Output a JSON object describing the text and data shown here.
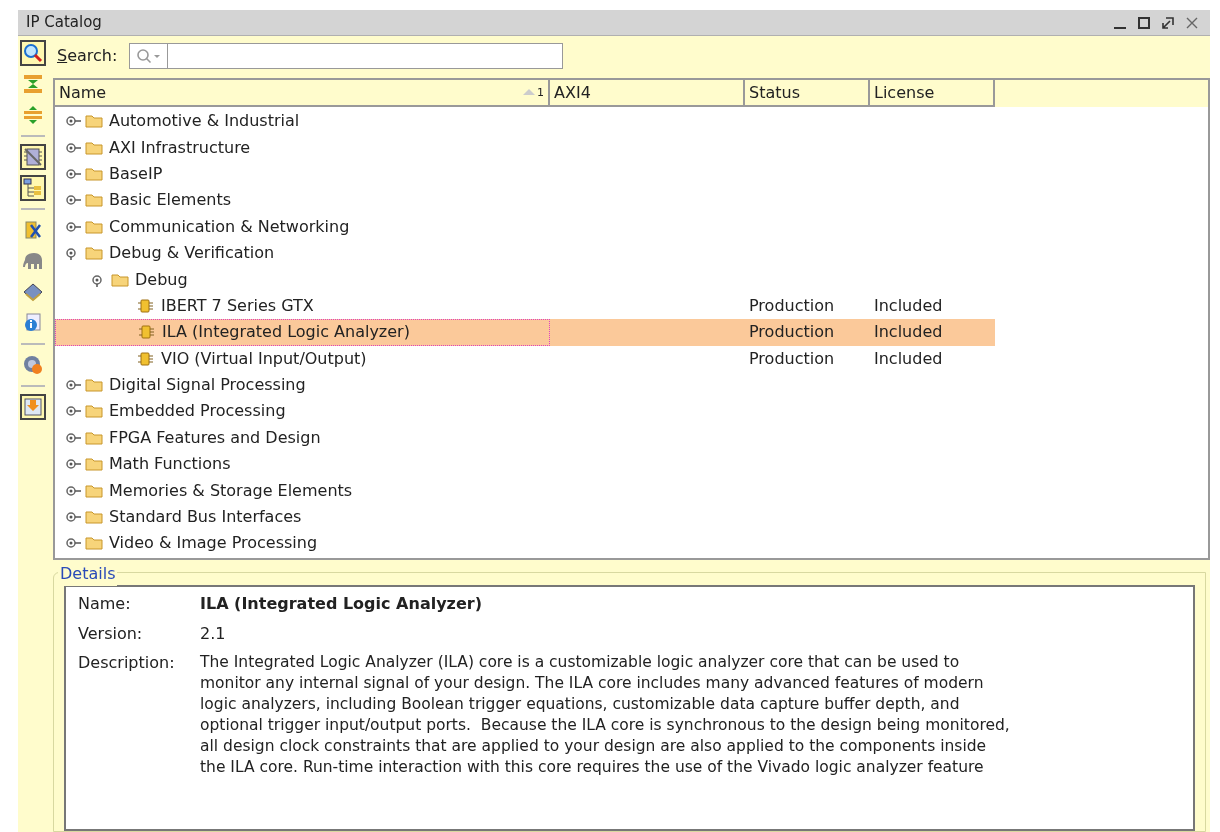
{
  "window": {
    "title": "IP Catalog",
    "controls": [
      {
        "kind": "minimize"
      },
      {
        "kind": "maximize"
      },
      {
        "kind": "restore"
      },
      {
        "kind": "close"
      }
    ]
  },
  "toolbar": [
    {
      "kind": "search",
      "pressed": true
    },
    {
      "kind": "collapse",
      "pressed": false
    },
    {
      "kind": "expand",
      "pressed": false
    },
    {
      "kind": "sep"
    },
    {
      "kind": "hide",
      "pressed": true
    },
    {
      "kind": "group",
      "pressed": true
    },
    {
      "kind": "sep"
    },
    {
      "kind": "customize",
      "pressed": false
    },
    {
      "kind": "elephant",
      "pressed": false
    },
    {
      "kind": "book",
      "pressed": false
    },
    {
      "kind": "info",
      "pressed": false
    },
    {
      "kind": "sep"
    },
    {
      "kind": "settings",
      "pressed": false
    },
    {
      "kind": "sep"
    },
    {
      "kind": "download",
      "pressed": true
    }
  ],
  "search": {
    "mnemonic": "S",
    "rest": "earch:"
  },
  "table": {
    "columns": [
      {
        "label": "Name",
        "sort": "1"
      },
      {
        "label": "AXI4"
      },
      {
        "label": "Status"
      },
      {
        "label": "License"
      }
    ],
    "rows": [
      {
        "kind": "folder",
        "name": "Automotive & Industrial",
        "expanded": false,
        "selected": false
      },
      {
        "kind": "folder",
        "name": "AXI Infrastructure",
        "expanded": false,
        "selected": false
      },
      {
        "kind": "folder",
        "name": "BaseIP",
        "expanded": false,
        "selected": false
      },
      {
        "kind": "folder",
        "name": "Basic Elements",
        "expanded": false,
        "selected": false
      },
      {
        "kind": "folder",
        "name": "Communication & Networking",
        "expanded": false,
        "selected": false
      },
      {
        "kind": "folder",
        "name": "Debug & Verification",
        "expanded": true,
        "selected": false,
        "children": [
          {
            "kind": "folder",
            "name": "Debug",
            "expanded": true,
            "selected": false,
            "children": [
              {
                "kind": "ip",
                "name": "IBERT 7 Series GTX",
                "status": "Production",
                "license": "Included",
                "selected": false
              },
              {
                "kind": "ip",
                "name": "ILA (Integrated Logic Analyzer)",
                "status": "Production",
                "license": "Included",
                "selected": true
              },
              {
                "kind": "ip",
                "name": "VIO (Virtual Input/Output)",
                "status": "Production",
                "license": "Included",
                "selected": false
              }
            ]
          }
        ]
      },
      {
        "kind": "folder",
        "name": "Digital Signal Processing",
        "expanded": false,
        "selected": false
      },
      {
        "kind": "folder",
        "name": "Embedded Processing",
        "expanded": false,
        "selected": false
      },
      {
        "kind": "folder",
        "name": "FPGA Features and Design",
        "expanded": false,
        "selected": false
      },
      {
        "kind": "folder",
        "name": "Math Functions",
        "expanded": false,
        "selected": false
      },
      {
        "kind": "folder",
        "name": "Memories & Storage Elements",
        "expanded": false,
        "selected": false
      },
      {
        "kind": "folder",
        "name": "Standard Bus Interfaces",
        "expanded": false,
        "selected": false
      },
      {
        "kind": "folder",
        "name": "Video & Image Processing",
        "expanded": false,
        "selected": false
      }
    ]
  },
  "details": {
    "title": "Details",
    "fields": [
      {
        "kind": "bold",
        "label": "Name:",
        "value": "ILA (Integrated Logic Analyzer)"
      },
      {
        "kind": "plain",
        "label": "Version:",
        "value": "2.1"
      },
      {
        "kind": "lines",
        "label": "Description:",
        "lines": [
          "The Integrated Logic Analyzer (ILA) core is a customizable logic analyzer core that can be used to",
          "monitor any internal signal of your design. The ILA core includes many advanced features of modern",
          "logic analyzers, including Boolean trigger equations, customizable data capture buffer depth, and",
          "optional trigger input/output ports.  Because the ILA core is synchronous to the design being monitored,",
          "all design clock constraints that are applied to your design are also applied to the components inside",
          "the ILA core. Run-time interaction with this core requires the use of the Vivado logic analyzer feature"
        ]
      }
    ]
  }
}
